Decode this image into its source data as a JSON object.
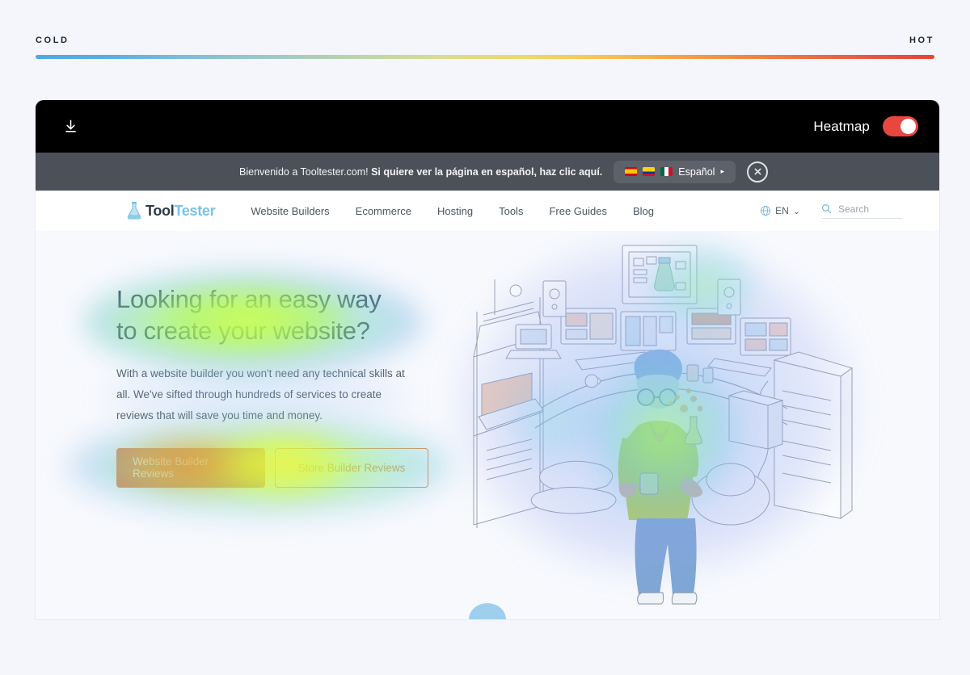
{
  "legend": {
    "cold_label": "COLD",
    "hot_label": "HOT",
    "cold_color": "#4fa8e8",
    "hot_color": "#e64535"
  },
  "toolbar": {
    "download_icon": "download-icon",
    "heatmap_label": "Heatmap",
    "heatmap_enabled": true,
    "toggle_color": "#e8473f",
    "background": "#000000"
  },
  "notice": {
    "text_plain": "Bienvenido a Tooltester.com! ",
    "text_bold": "Si quiere ver la página en español, haz clic aquí.",
    "language_button": "Español",
    "caret": "▸",
    "flags": [
      "Spain",
      "Colombia",
      "Mexico"
    ],
    "close_icon": "close-icon",
    "background": "#4b5059"
  },
  "sitenav": {
    "logo_part_a": "Tool",
    "logo_part_b": "Tester",
    "links": [
      {
        "label": "Website Builders"
      },
      {
        "label": "Ecommerce"
      },
      {
        "label": "Hosting"
      },
      {
        "label": "Tools"
      },
      {
        "label": "Free Guides"
      },
      {
        "label": "Blog"
      }
    ],
    "language": "EN",
    "language_caret": "⌄",
    "search_placeholder": "Search"
  },
  "hero": {
    "title_line1": "Looking for an easy way",
    "title_line2": "to create your website?",
    "paragraph": "With a website builder you won't need any technical skills at all. We've sifted through hundreds of services to create reviews that will save you time and money.",
    "cta_primary": "Website Builder Reviews",
    "cta_secondary": "Store Builder Reviews",
    "primary_color": "#e8894a",
    "background": "#f7f9fd"
  },
  "page": {
    "background": "#f4f6fb"
  }
}
